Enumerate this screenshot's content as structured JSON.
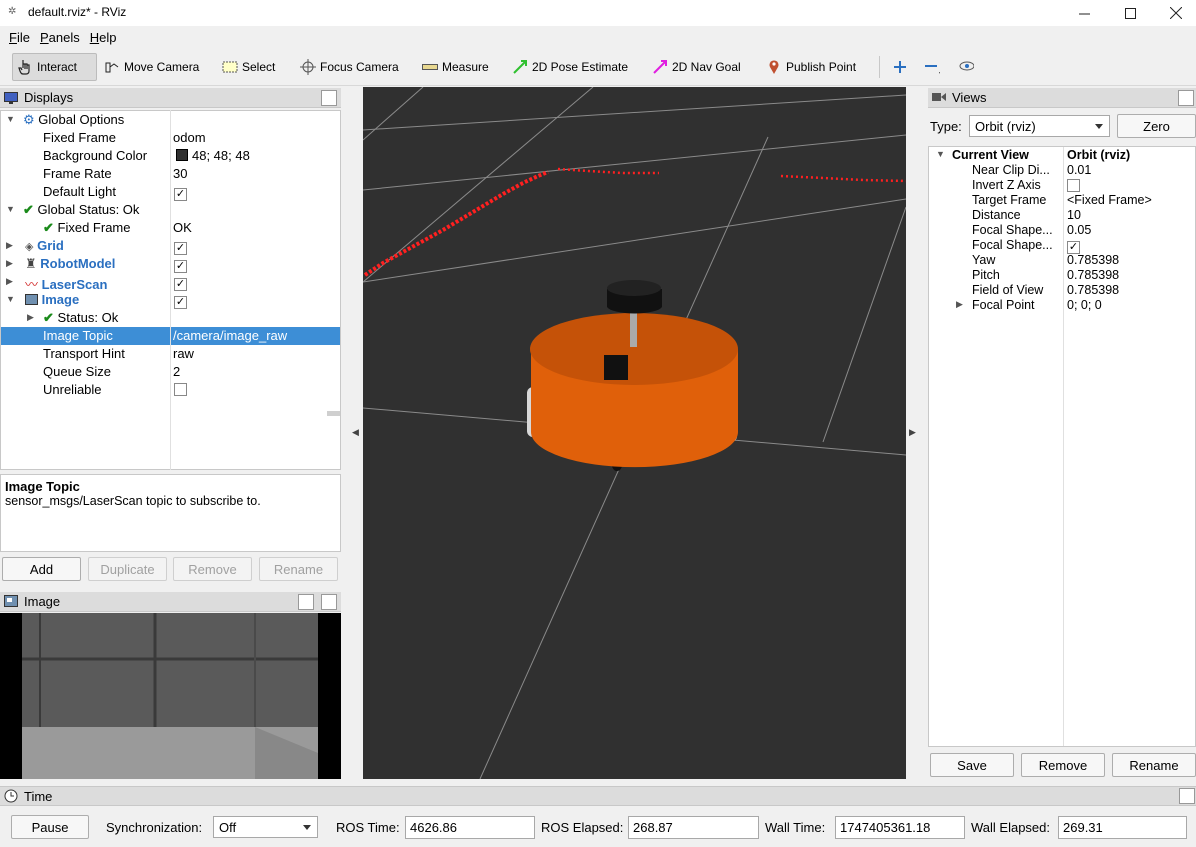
{
  "window": {
    "title": "default.rviz* - RViz"
  },
  "menu": [
    "File",
    "Panels",
    "Help"
  ],
  "toolbar": {
    "interact": "Interact",
    "move_camera": "Move Camera",
    "select": "Select",
    "focus_camera": "Focus Camera",
    "measure": "Measure",
    "pose_estimate": "2D Pose Estimate",
    "nav_goal": "2D Nav Goal",
    "publish_point": "Publish Point"
  },
  "displays": {
    "title": "Displays",
    "rows": [
      {
        "label": "Global Options",
        "value": ""
      },
      {
        "label": "Fixed Frame",
        "value": "odom"
      },
      {
        "label": "Background Color",
        "value": "48; 48; 48"
      },
      {
        "label": "Frame Rate",
        "value": "30"
      },
      {
        "label": "Default Light",
        "value": ""
      },
      {
        "label": "Global Status: Ok",
        "value": ""
      },
      {
        "label": "Fixed Frame",
        "value": "OK"
      },
      {
        "label": "Grid",
        "value": ""
      },
      {
        "label": "RobotModel",
        "value": ""
      },
      {
        "label": "LaserScan",
        "value": ""
      },
      {
        "label": "Image",
        "value": ""
      },
      {
        "label": "Status: Ok",
        "value": ""
      },
      {
        "label": "Image Topic",
        "value": "/camera/image_raw"
      },
      {
        "label": "Transport Hint",
        "value": "raw"
      },
      {
        "label": "Queue Size",
        "value": "2"
      },
      {
        "label": "Unreliable",
        "value": ""
      }
    ],
    "description_title": "Image Topic",
    "description_text": "sensor_msgs/LaserScan topic to subscribe to.",
    "buttons": {
      "add": "Add",
      "duplicate": "Duplicate",
      "remove": "Remove",
      "rename": "Rename"
    }
  },
  "image_panel": {
    "title": "Image"
  },
  "views": {
    "title": "Views",
    "type_label": "Type:",
    "type_value": "Orbit (rviz)",
    "zero": "Zero",
    "rows": [
      {
        "label": "Current View",
        "value": "Orbit (rviz)"
      },
      {
        "label": "Near Clip Di...",
        "value": "0.01"
      },
      {
        "label": "Invert Z Axis",
        "value": ""
      },
      {
        "label": "Target Frame",
        "value": "<Fixed Frame>"
      },
      {
        "label": "Distance",
        "value": "10"
      },
      {
        "label": "Focal Shape...",
        "value": "0.05"
      },
      {
        "label": "Focal Shape...",
        "value": ""
      },
      {
        "label": "Yaw",
        "value": "0.785398"
      },
      {
        "label": "Pitch",
        "value": "0.785398"
      },
      {
        "label": "Field of View",
        "value": "0.785398"
      },
      {
        "label": "Focal Point",
        "value": "0; 0; 0"
      }
    ],
    "buttons": {
      "save": "Save",
      "remove": "Remove",
      "rename": "Rename"
    }
  },
  "time": {
    "title": "Time",
    "pause": "Pause",
    "sync_label": "Synchronization:",
    "sync_value": "Off",
    "ros_time_label": "ROS Time:",
    "ros_time": "4626.86",
    "ros_elapsed_label": "ROS Elapsed:",
    "ros_elapsed": "268.87",
    "wall_time_label": "Wall Time:",
    "wall_time": "1747405361.18",
    "wall_elapsed_label": "Wall Elapsed:",
    "wall_elapsed": "269.31"
  },
  "colors": {
    "selection": "#3d8ed6",
    "robot": "#e0600a",
    "scan": "#ff0000",
    "background3d": "#303030"
  }
}
